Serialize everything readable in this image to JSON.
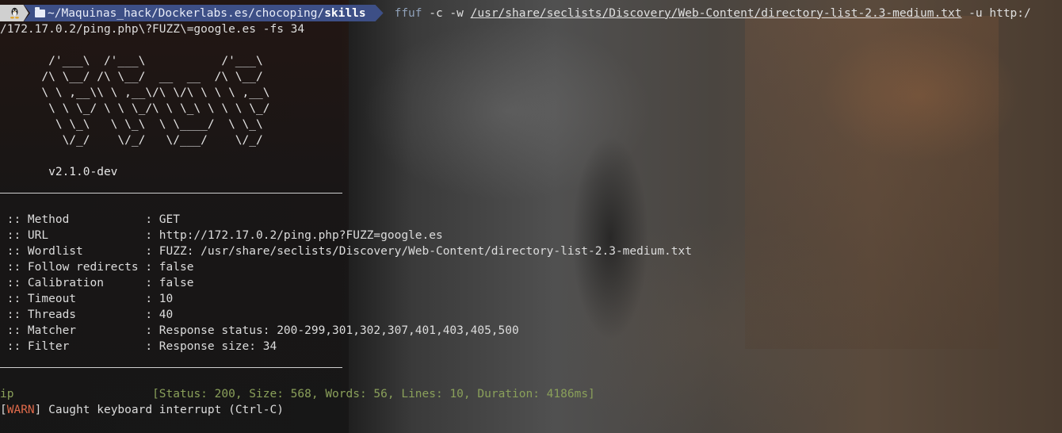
{
  "prompt": {
    "os_icon": "linux-tux-icon",
    "path_prefix": "~/Maquinas_hack/Dockerlabs.es/chocoping/",
    "path_current": "skills",
    "cmd_tool": "ffuf",
    "cmd_part1": " -c -w ",
    "cmd_wordlist": "/usr/share/seclists/Discovery/Web-Content/directory-list-2.3-medium.txt",
    "cmd_part2": " -u http:/",
    "cmd_wrap": "/172.17.0.2/ping.php\\?FUZZ\\=google.es -fs 34"
  },
  "banner": [
    "       /'___\\  /'___\\           /'___\\",
    "      /\\ \\__/ /\\ \\__/  __  __  /\\ \\__/",
    "      \\ \\ ,__\\\\ \\ ,__\\/\\ \\/\\ \\ \\ \\ ,__\\",
    "       \\ \\ \\_/ \\ \\ \\_/\\ \\ \\_\\ \\ \\ \\ \\_/",
    "        \\ \\_\\   \\ \\_\\  \\ \\____/  \\ \\_\\",
    "         \\/_/    \\/_/   \\/___/    \\/_/"
  ],
  "version": "       v2.1.0-dev",
  "config": [
    " :: Method           : GET",
    " :: URL              : http://172.17.0.2/ping.php?FUZZ=google.es",
    " :: Wordlist         : FUZZ: /usr/share/seclists/Discovery/Web-Content/directory-list-2.3-medium.txt",
    " :: Follow redirects : false",
    " :: Calibration      : false",
    " :: Timeout          : 10",
    " :: Threads          : 40",
    " :: Matcher          : Response status: 200-299,301,302,307,401,403,405,500",
    " :: Filter           : Response size: 34"
  ],
  "result": {
    "word": "ip",
    "padding": "                    ",
    "status": "[Status: 200, Size: 568, Words: 56, Lines: 10, Duration: 4186ms]"
  },
  "warn": {
    "open": "[",
    "label": "WARN",
    "close": "]",
    "message": " Caught keyboard interrupt (Ctrl-C)"
  },
  "colors": {
    "path_bg": "#3d4f86",
    "result_green": "#8aa05a",
    "warn_red": "#e06a4a"
  }
}
